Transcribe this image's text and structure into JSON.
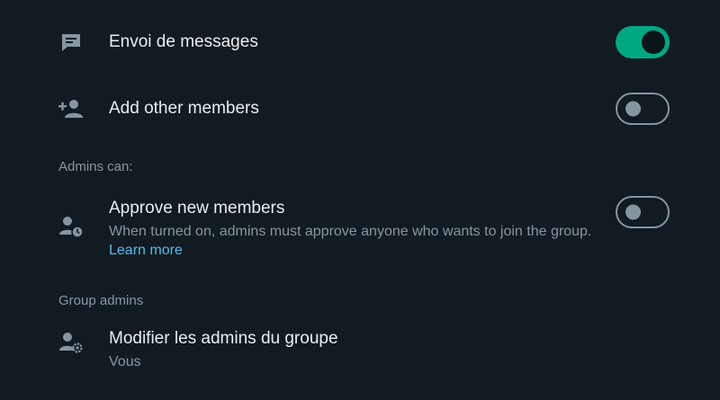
{
  "settings": {
    "send_messages": {
      "label": "Envoi de messages",
      "icon": "message-icon",
      "enabled": true
    },
    "add_members": {
      "label": "Add other members",
      "icon": "add-person-icon",
      "enabled": false
    }
  },
  "admins_section": {
    "header": "Admins can:",
    "approve_members": {
      "label": "Approve new members",
      "description": "When turned on, admins must approve anyone who wants to join the group.",
      "link": "Learn more",
      "icon": "person-clock-icon",
      "enabled": false
    }
  },
  "group_admins_section": {
    "header": "Group admins",
    "edit_admins": {
      "label": "Modifier les admins du groupe",
      "value": "Vous",
      "icon": "person-gear-icon"
    }
  },
  "colors": {
    "background": "#121b22",
    "accent_green": "#00a884",
    "secondary_text": "#8696a0",
    "link": "#53bdeb"
  }
}
